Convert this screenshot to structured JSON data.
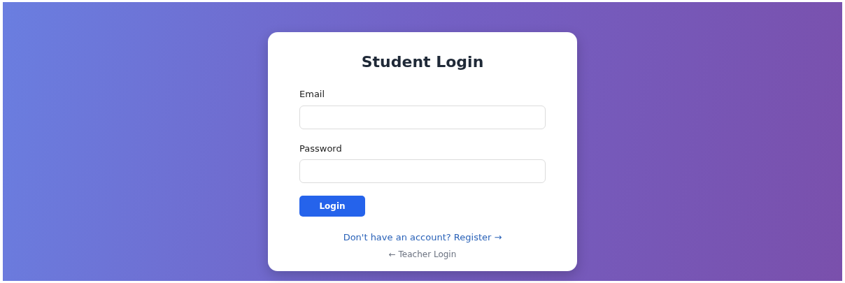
{
  "title": "Student Login",
  "fields": [
    {
      "label": "Email"
    },
    {
      "label": "Password"
    }
  ],
  "submit": "Login",
  "links": [
    {
      "text": "Don't have an account? Register →",
      "kind": "primary"
    },
    {
      "text": "← Teacher Login",
      "kind": "muted"
    }
  ]
}
